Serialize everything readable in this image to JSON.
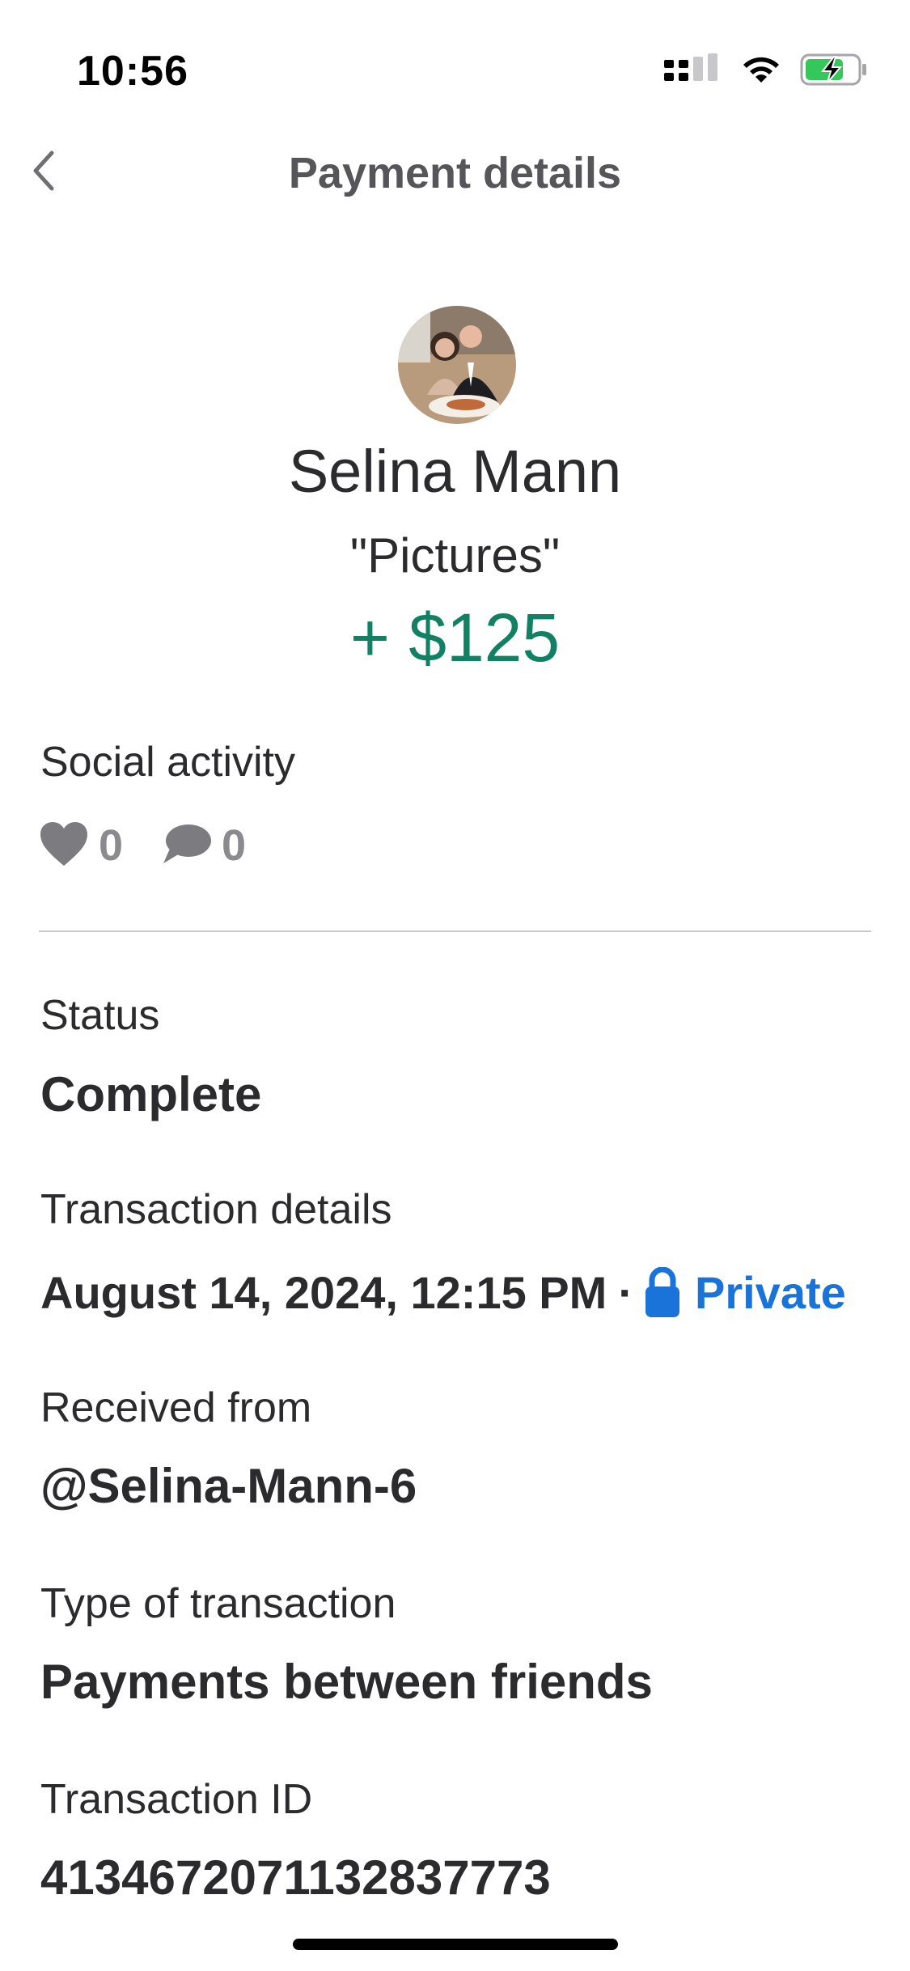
{
  "status_bar": {
    "time": "10:56"
  },
  "nav": {
    "title": "Payment details",
    "back_icon": "chevron-left-icon"
  },
  "profile": {
    "name": "Selina Mann",
    "note": "\"Pictures\"",
    "amount": "+ $125",
    "amount_color": "#118063"
  },
  "social": {
    "label": "Social activity",
    "likes": "0",
    "comments": "0",
    "icons": [
      "heart-icon",
      "comment-bubble-icon"
    ]
  },
  "status": {
    "label": "Status",
    "value": "Complete"
  },
  "transaction_details": {
    "label": "Transaction details",
    "datetime": "August 14, 2024, 12:15 PM",
    "separator": "·",
    "privacy": "Private",
    "privacy_color": "#1a73d9",
    "privacy_icon": "lock-icon"
  },
  "received_from": {
    "label": "Received from",
    "value": "@Selina-Mann-6"
  },
  "transaction_type": {
    "label": "Type of transaction",
    "value": "Payments between friends"
  },
  "transaction_id": {
    "label": "Transaction ID",
    "value": "4134672071132837773"
  }
}
